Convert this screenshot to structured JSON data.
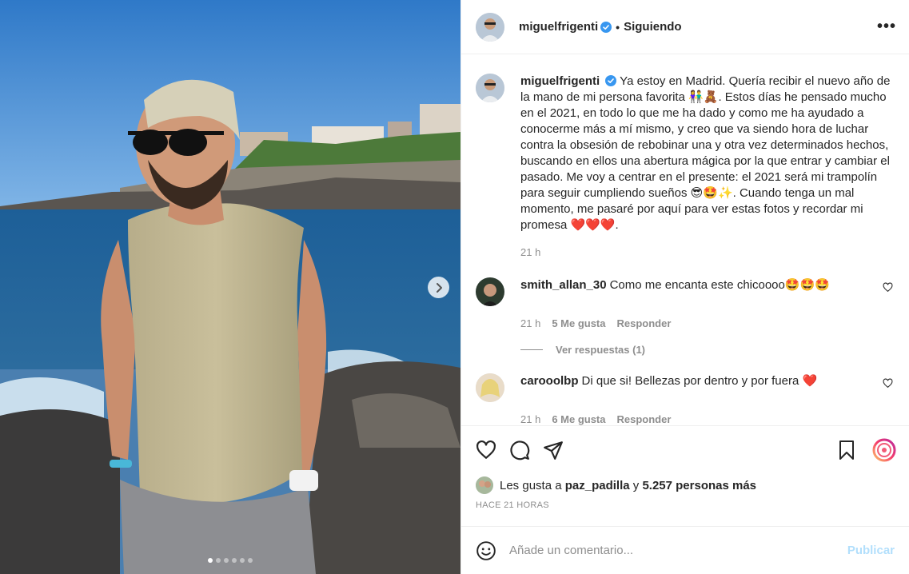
{
  "post": {
    "username": "miguelfrigenti",
    "follow_status": "Siguiendo",
    "separator": "•",
    "more_label": "•••",
    "caption": "Ya estoy en Madrid. Quería recibir el nuevo año de la mano de mi persona favorita 👫🧸. Estos días he pensado mucho en el 2021, en todo lo que me ha dado y como me ha ayudado a conocerme más a mí mismo, y creo que va siendo hora de luchar contra la obsesión de rebobinar una y otra vez determinados hechos, buscando en ellos una abertura mágica por la que entrar y cambiar el pasado. Me voy a centrar en el presente: el 2021 será mi trampolín para seguir cumpliendo sueños 😎🤩✨. Cuando tenga un mal momento, me pasaré por aquí para ver estas fotos y recordar mi promesa ❤️❤️❤️.",
    "caption_time": "21 h"
  },
  "comments": [
    {
      "username": "smith_allan_30",
      "text": "Como me encanta este chicoooo🤩🤩🤩",
      "time": "21 h",
      "likes": "5 Me gusta",
      "reply_label": "Responder",
      "view_replies": "Ver respuestas (1)"
    },
    {
      "username": "carooolbp",
      "text": "Di que si! Bellezas por dentro y por fuera ❤️",
      "time": "21 h",
      "likes": "6 Me gusta",
      "reply_label": "Responder"
    }
  ],
  "likes_line": {
    "prefix": "Les gusta a",
    "user": "paz_padilla",
    "conj": "y",
    "others": "5.257 personas más"
  },
  "time_ago": "HACE 21 HORAS",
  "comment_box": {
    "placeholder": "Añade un comentario...",
    "post_label": "Publicar"
  },
  "carousel": {
    "total": 6,
    "active": 1
  },
  "colors": {
    "verified": "#3897f0",
    "heart": "#ed4956",
    "muted": "#8e8e8e",
    "post_disabled": "#b2dffc"
  },
  "icons": [
    "heart-icon",
    "comment-icon",
    "share-icon",
    "bookmark-icon",
    "emoji-icon",
    "more-icon",
    "chevron-right-icon",
    "verified-badge-icon"
  ]
}
